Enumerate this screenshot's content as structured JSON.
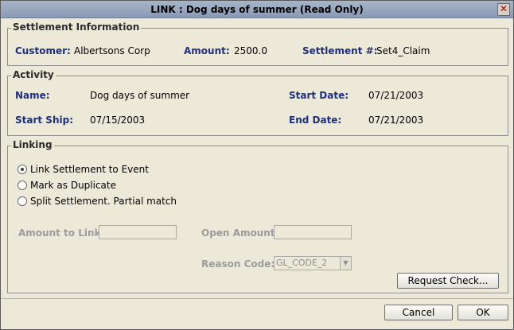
{
  "window": {
    "title": "LINK : Dog days of summer (Read Only)"
  },
  "settlement": {
    "legend": "Settlement Information",
    "customer_label": "Customer:",
    "customer_value": "Albertsons Corp",
    "amount_label": "Amount:",
    "amount_value": "2500.0",
    "settlement_label": "Settlement #:",
    "settlement_value": "Set4_Claim"
  },
  "activity": {
    "legend": "Activity",
    "name_label": "Name:",
    "name_value": "Dog days of summer",
    "start_date_label": "Start Date:",
    "start_date_value": "07/21/2003",
    "start_ship_label": "Start Ship:",
    "start_ship_value": "07/15/2003",
    "end_date_label": "End Date:",
    "end_date_value": "07/21/2003"
  },
  "linking": {
    "legend": "Linking",
    "options": [
      {
        "label": "Link Settlement to Event",
        "selected": true
      },
      {
        "label": "Mark as Duplicate",
        "selected": false
      },
      {
        "label": "Split Settlement. Partial match",
        "selected": false
      }
    ],
    "amount_to_link_label": "Amount to Link:",
    "amount_to_link_value": "",
    "open_amount_label": "Open Amount:",
    "open_amount_value": "",
    "reason_code_label": "Reason Code:",
    "reason_code_value": "GL_CODE_2",
    "request_check_label": "Request Check..."
  },
  "footer": {
    "cancel_label": "Cancel",
    "ok_label": "OK"
  }
}
